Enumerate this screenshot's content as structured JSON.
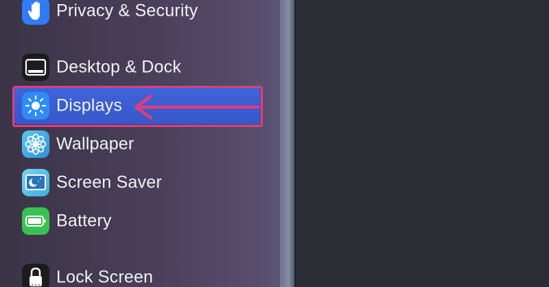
{
  "sidebar": {
    "items": [
      {
        "label": "Privacy & Security",
        "icon": "hand-icon",
        "icon_color": "#2f7cf6"
      },
      {
        "label": "Desktop & Dock",
        "icon": "dock-icon",
        "icon_color": "#1c1c1e"
      },
      {
        "label": "Displays",
        "icon": "sun-icon",
        "icon_color": "#2f8cf6",
        "selected": true
      },
      {
        "label": "Wallpaper",
        "icon": "flower-icon",
        "icon_color": "#3aa7e8"
      },
      {
        "label": "Screen Saver",
        "icon": "screen-saver-icon",
        "icon_color": "#5ec4e8"
      },
      {
        "label": "Battery",
        "icon": "battery-icon",
        "icon_color": "#3bc152"
      },
      {
        "label": "Lock Screen",
        "icon": "lock-icon",
        "icon_color": "#1c1c1e"
      }
    ]
  },
  "annotation": {
    "highlight_color": "#e23d79",
    "arrow_color": "#e23d79"
  },
  "colors": {
    "selection": "#3f63d9",
    "content_background": "#2b2d34"
  }
}
